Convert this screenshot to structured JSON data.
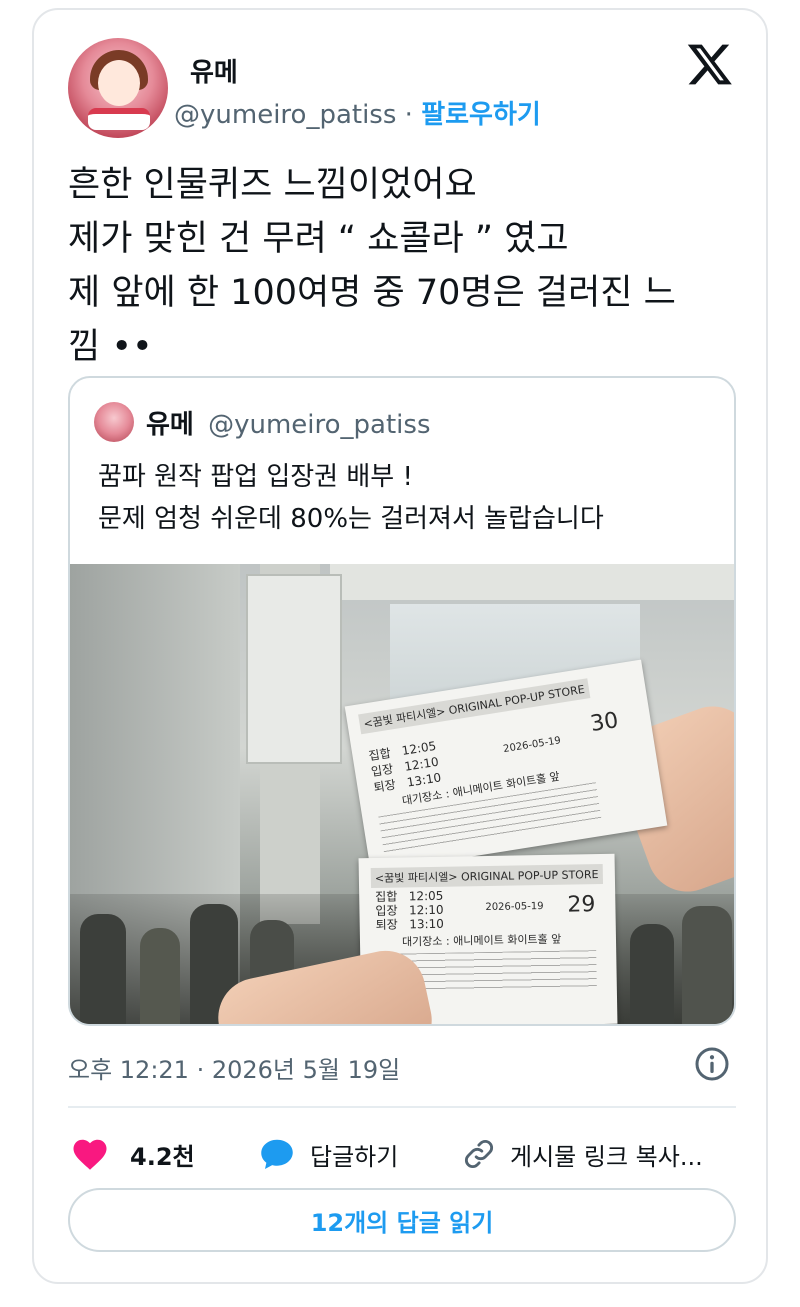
{
  "author": {
    "display_name": "유메",
    "handle": "@yumeiro_patiss",
    "separator": "·",
    "follow_label": "팔로우하기"
  },
  "tweet": {
    "lines": [
      "흔한 인물퀴즈 느낌이었어요",
      "제가 맞힌 건 무려 “ 쇼콜라 ” 였고",
      "제 앞에 한 100여명 중 70명은 걸러진 느",
      "낌 ••"
    ]
  },
  "quoted_tweet": {
    "display_name": "유메",
    "handle": "@yumeiro_patiss",
    "lines": [
      "꿈파 원작 팝업 입장권 배부 !",
      "문제 엄청 쉬운데 80%는 걸러져서 놀랍습니다"
    ],
    "photo": {
      "tickets": [
        {
          "header": "<꿈빛 파티시엘> ORIGINAL POP-UP STORE",
          "rows": [
            {
              "label": "집합",
              "time": "12:05"
            },
            {
              "label": "입장",
              "time": "12:10"
            },
            {
              "label": "퇴장",
              "time": "13:10"
            }
          ],
          "date": "2026-05-19",
          "number": "30",
          "place": "대기장소 : 애니메이트 화이트홀 앞"
        },
        {
          "header": "<꿈빛 파티시엘> ORIGINAL POP-UP STORE",
          "rows": [
            {
              "label": "집합",
              "time": "12:05"
            },
            {
              "label": "입장",
              "time": "12:10"
            },
            {
              "label": "퇴장",
              "time": "13:10"
            }
          ],
          "date": "2026-05-19",
          "number": "29",
          "place": "대기장소 : 애니메이트 화이트홀 앞"
        }
      ]
    }
  },
  "meta": {
    "timestamp": "오후 12:21 · 2026년 5월 19일"
  },
  "actions": {
    "like_count": "4.2천",
    "reply_label": "답글하기",
    "copy_link_label": "게시물 링크 복사..."
  },
  "read_replies_label": "12개의 답글 읽기",
  "colors": {
    "accent": "#1d9bf0",
    "like": "#f91880",
    "text": "#0f1419",
    "secondary": "#536471",
    "border": "#cfd9de"
  },
  "icons": [
    "x-logo-icon",
    "info-icon",
    "heart-icon",
    "reply-bubble-icon",
    "link-icon"
  ]
}
